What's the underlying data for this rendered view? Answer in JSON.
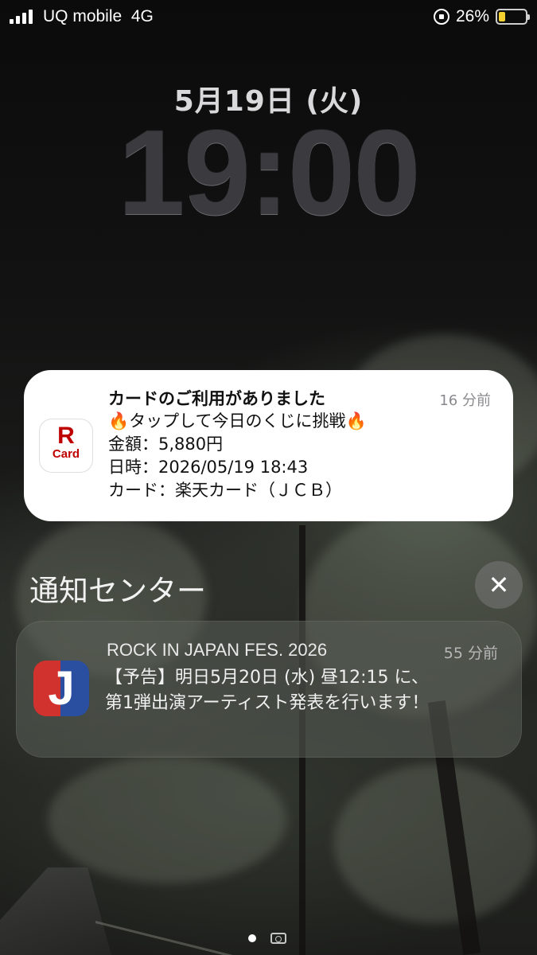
{
  "status_bar": {
    "carrier": "UQ mobile",
    "network": "4G",
    "battery": "26%",
    "battery_level": 0.26,
    "icons": [
      "signal-icon",
      "rotation-lock-icon",
      "battery-icon"
    ]
  },
  "lock_screen": {
    "date": "5月19日 (火)",
    "time": "19:00"
  },
  "notification_1": {
    "app_icon": "rakuten-card-icon",
    "icon_text_top": "R",
    "icon_text_bottom": "Card",
    "title": "カードのご利用がありました",
    "time_ago": "16 分前",
    "lines": [
      "🔥タップして今日のくじに挑戦🔥",
      "金額：5,880円",
      "日時：2026/05/19 18:43",
      "カード：楽天カード（ＪＣＢ）"
    ]
  },
  "notification_center": {
    "title": "通知センター",
    "close_symbol": "✕"
  },
  "notification_2": {
    "app_icon": "rock-in-japan-icon",
    "icon_letter": "J",
    "title": "ROCK IN JAPAN FES. 2026",
    "time_ago": "55 分前",
    "lines": [
      "【予告】明日5月20日 (水) 昼12:15 に、",
      "第1弾出演アーティスト発表を行います！"
    ]
  },
  "colors": {
    "battery_fill": "#f4d130",
    "rakuten_red": "#bf0000",
    "rij_red": "#d2322d",
    "rij_blue": "#2a4ea0"
  }
}
